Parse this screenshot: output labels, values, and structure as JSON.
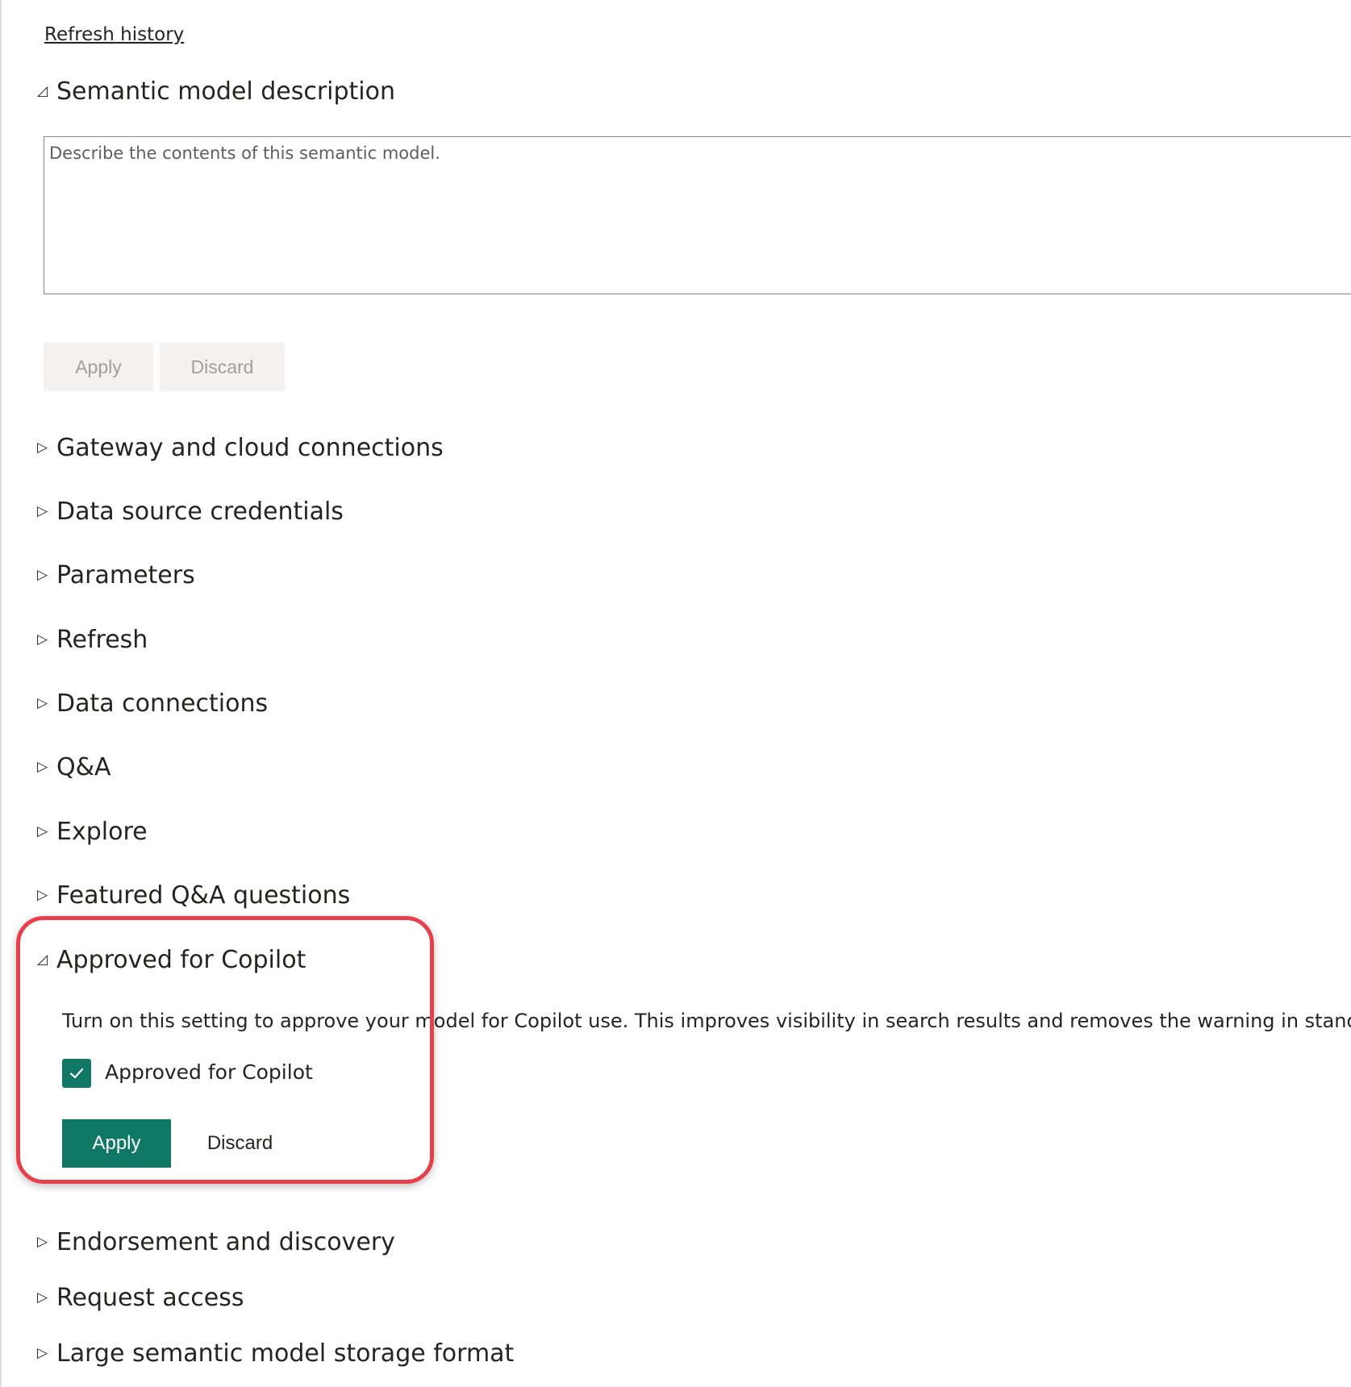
{
  "links": {
    "refresh_history": "Refresh history"
  },
  "description_section": {
    "title": "Semantic model description",
    "placeholder": "Describe the contents of this semantic model.",
    "apply_label": "Apply",
    "discard_label": "Discard"
  },
  "collapsed_sections": [
    "Gateway and cloud connections",
    "Data source credentials",
    "Parameters",
    "Refresh",
    "Data connections",
    "Q&A",
    "Explore",
    "Featured Q&A questions"
  ],
  "copilot_section": {
    "title": "Approved for Copilot",
    "description": "Turn on this setting to approve your model for Copilot use. This improves visibility in search results and removes the warning in standalone",
    "checkbox_label": "Approved for Copilot",
    "checkbox_checked": true,
    "apply_label": "Apply",
    "discard_label": "Discard"
  },
  "trailing_sections": [
    "Endorsement and discovery",
    "Request access",
    "Large semantic model storage format"
  ],
  "icons": {
    "expanded": "collapse-triangle-icon",
    "collapsed": "expand-triangle-icon",
    "checkbox": "checkmark-icon"
  },
  "colors": {
    "primary": "#117865",
    "highlight_border": "#e8404a",
    "disabled_bg": "#f3f2f1",
    "disabled_text": "#a19f9d"
  }
}
